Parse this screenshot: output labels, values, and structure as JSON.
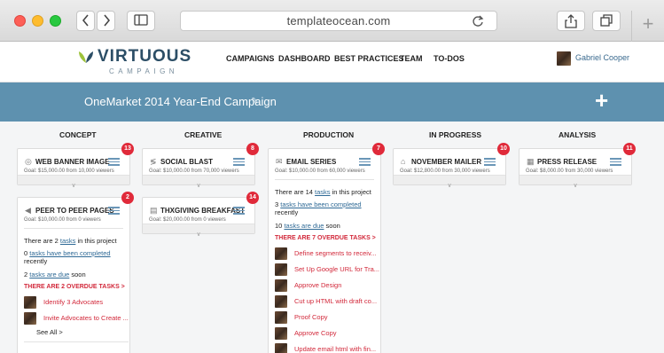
{
  "browser": {
    "url": "templateocean.com",
    "back_icon": "chevron-left-icon",
    "forward_icon": "chevron-right-icon",
    "sidebar_icon": "sidebar-icon",
    "reload_icon": "reload-icon",
    "share_icon": "share-icon",
    "tabs_icon": "tabs-icon",
    "new_tab_label": "+"
  },
  "header": {
    "logo_word": "VIRTUOUS",
    "logo_sub": "CAMPAIGN",
    "nav": [
      "CAMPAIGNS",
      "DASHBOARD",
      "BEST PRACTICES",
      "TEAM",
      "TO-DOS"
    ],
    "user_name": "Gabriel Cooper"
  },
  "banner": {
    "title": "OneMarket 2014 Year-End Campaign",
    "edit_icon": "edit-icon",
    "add_label": "+"
  },
  "columns": [
    {
      "label": "CONCEPT"
    },
    {
      "label": "CREATIVE"
    },
    {
      "label": "PRODUCTION"
    },
    {
      "label": "IN PROGRESS"
    },
    {
      "label": "ANALYSIS"
    }
  ],
  "cards": {
    "web_banner": {
      "title": "WEB BANNER IMAGE",
      "goal": "Goal: $15,000.00 from 10,000 viewers",
      "badge": "13"
    },
    "peer_to_peer": {
      "title": "PEER TO PEER PAGES",
      "goal": "Goal: $10,000.00 from 0 viewers",
      "badge": "2",
      "tasks_prefix": "There are 2 ",
      "tasks_link": "tasks",
      "tasks_suffix": " in this project",
      "completed_prefix": "0 ",
      "completed_link": "tasks have been completed",
      "recently": "recently",
      "due_prefix": "2 ",
      "due_link": "tasks are due",
      "due_suffix": " soon",
      "overdue": "THERE ARE 2 OVERDUE TASKS  >",
      "overdue_tasks": [
        "Identify 3 Advocates",
        "Invite Advocates to Create ..."
      ],
      "see_all": "See All  >"
    },
    "social_blast": {
      "title": "SOCIAL BLAST",
      "goal": "Goal: $10,000.00 from 70,000 viewers",
      "badge": "8"
    },
    "thanksgiving": {
      "title": "THXGIVING BREAKFAST",
      "goal": "Goal: $20,000.00 from 0 viewers",
      "badge": "14"
    },
    "email_series": {
      "title": "EMAIL SERIES",
      "goal": "Goal: $10,000.00 from 60,000 viewers",
      "badge": "7",
      "tasks_prefix": "There are 14 ",
      "tasks_link": "tasks",
      "tasks_suffix": " in this project",
      "completed_prefix": "3 ",
      "completed_link": "tasks have been completed",
      "recently": "recently",
      "due_prefix": "10 ",
      "due_link": "tasks are due",
      "due_suffix": " soon",
      "overdue": "THERE ARE 7 OVERDUE TASKS  >",
      "overdue_tasks": [
        "Define segments to receiv...",
        "Set Up Google URL for Tra...",
        "Approve Design",
        "Cut up HTML with draft co...",
        "Proof Copy",
        "Approve Copy",
        "Update email html with fin..."
      ]
    },
    "november_mailer": {
      "title": "NOVEMBER MAILER",
      "goal": "Goal: $12,800.00 from 30,000 viewers",
      "badge": "10"
    },
    "press_release": {
      "title": "PRESS RELEASE",
      "goal": "Goal: $8,000.00 from 30,000 viewers",
      "badge": "11"
    }
  },
  "colors": {
    "accent": "#5e91af",
    "badge": "#e02a3a",
    "overdue": "#d2283a",
    "link": "#2f6a96"
  }
}
